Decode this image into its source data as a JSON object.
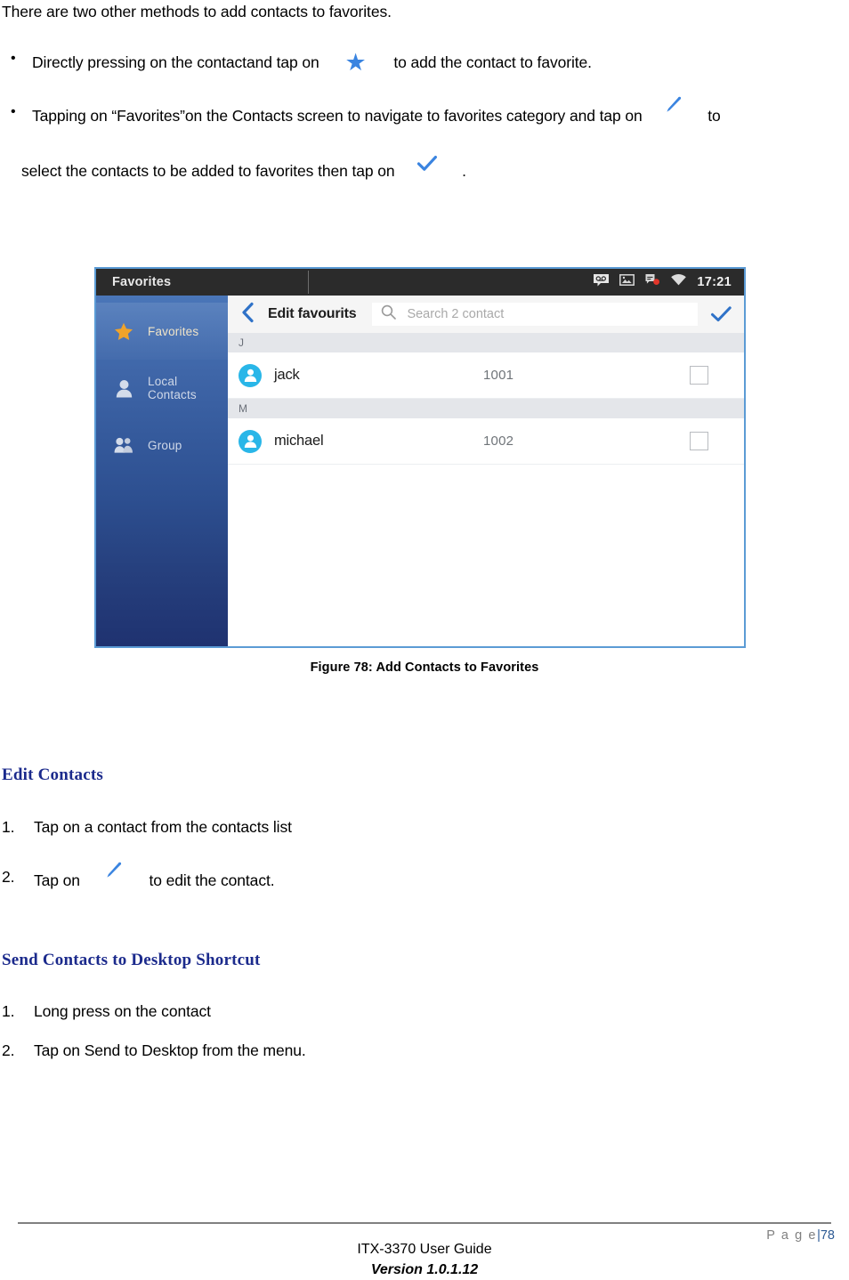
{
  "document": {
    "intro": "There are two other methods to add contacts to favorites.",
    "bullets": [
      {
        "marker": "•",
        "text_before": "Directly pressing on the contactand tap on",
        "icon": "star-icon",
        "text_after": "to add the contact to favorite."
      },
      {
        "marker": "•",
        "text_before": "Tapping on “Favorites”on the Contacts screen to navigate to favorites category and tap on",
        "icon": "pencil-icon",
        "text_after": "to",
        "continuation_before": "select the contacts to be added to favorites then tap on",
        "continuation_icon": "check-icon",
        "continuation_after": "."
      }
    ],
    "figure_caption": "Figure 78: Add Contacts to Favorites",
    "sections": [
      {
        "heading": "Edit Contacts",
        "steps": [
          {
            "num": "1.",
            "text_before": "Tap on a contact from the contacts list",
            "icon": "",
            "text_after": ""
          },
          {
            "num": "2.",
            "text_before": "Tap on",
            "icon": "pencil-icon",
            "text_after": "to edit the contact."
          }
        ]
      },
      {
        "heading": "Send Contacts to Desktop Shortcut",
        "steps": [
          {
            "num": "1.",
            "text_before": "Long press on the contact",
            "icon": "",
            "text_after": ""
          },
          {
            "num": "2.",
            "text_before": "Tap on Send to Desktop from the menu.",
            "icon": "",
            "text_after": ""
          }
        ]
      }
    ]
  },
  "figure": {
    "statusbar": {
      "title": "Favorites",
      "icons": [
        "voicemail-icon",
        "screenshot-icon",
        "missed-call-icon",
        "wifi-icon"
      ],
      "time": "17:21"
    },
    "sidenav": {
      "items": [
        {
          "label": "Favorites",
          "icon": "star-icon",
          "active": true
        },
        {
          "label": "Local\nContacts",
          "label_line1": "Local",
          "label_line2": "Contacts",
          "icon": "person-icon",
          "active": false
        },
        {
          "label": "Group",
          "icon": "group-icon",
          "active": false
        }
      ]
    },
    "toolbar": {
      "back_icon": "back-chevron-icon",
      "title": "Edit favourits",
      "search_icon": "search-icon",
      "search_value": "",
      "search_placeholder": "Search 2 contact",
      "confirm_icon": "check-icon"
    },
    "contacts": [
      {
        "section": "J",
        "name": "jack",
        "number": "1001",
        "checked": false
      },
      {
        "section": "M",
        "name": "michael",
        "number": "1002",
        "checked": false
      }
    ]
  },
  "footer": {
    "page_label": "P a g e",
    "page_separator": "|",
    "page_number": "78",
    "guide_title": "ITX-3370 User Guide",
    "version": "Version 1.0.1.12"
  },
  "colors": {
    "accent_blue": "#3a84e0",
    "heading_blue": "#1b2a8c",
    "frame_blue": "#5b9bd5",
    "sidenav_top": "#4a76b8",
    "sidenav_bottom": "#1f3270",
    "avatar_cyan": "#29b6e8",
    "star_orange": "#f0a32a",
    "footer_gray": "#808080",
    "page_num_blue": "#2e5b95"
  }
}
